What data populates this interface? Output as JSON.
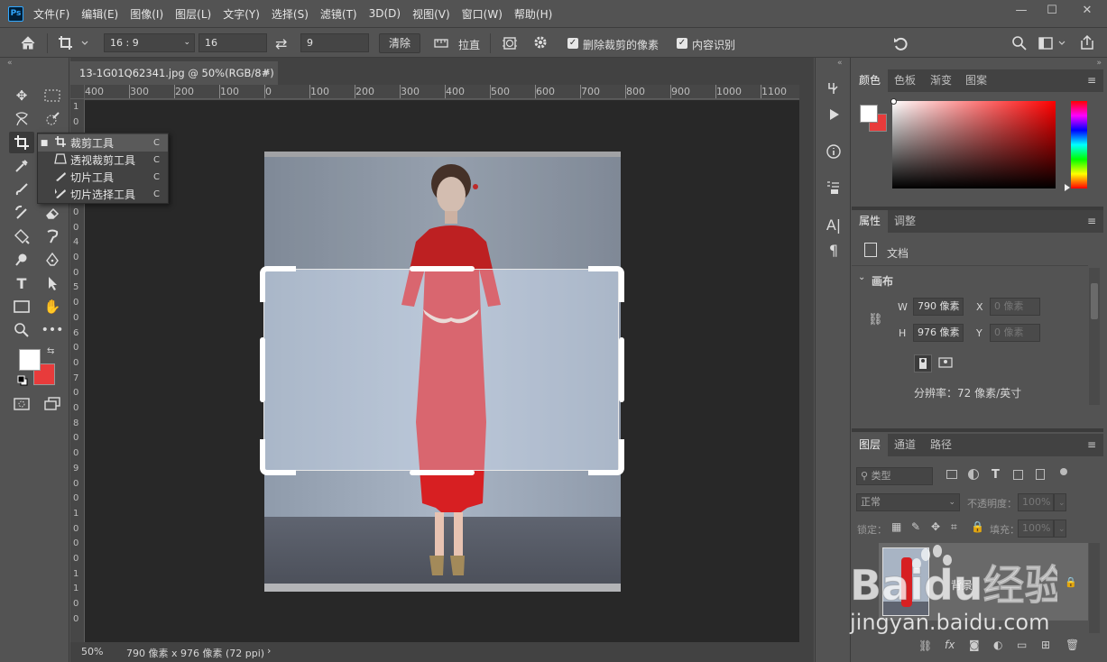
{
  "app": {
    "logo": "Ps"
  },
  "menu": [
    "文件(F)",
    "编辑(E)",
    "图像(I)",
    "图层(L)",
    "文字(Y)",
    "选择(S)",
    "滤镜(T)",
    "3D(D)",
    "视图(V)",
    "窗口(W)",
    "帮助(H)"
  ],
  "window_controls": {
    "minimize": "—",
    "maximize": "☐",
    "close": "✕"
  },
  "options": {
    "ratio_preset": "16 : 9",
    "width_value": "16",
    "swap_icon": "⇄",
    "height_value": "9",
    "clear_label": "清除",
    "straighten_label": "拉直",
    "delete_cropped_label": "删除裁剪的像素",
    "content_aware_label": "内容识别",
    "delete_cropped_checked": "✓",
    "content_aware_checked": "✓"
  },
  "document": {
    "tab_title": "13-1G01Q62341.jpg @ 50%(RGB/8#)",
    "tab_close": "✕",
    "zoom": "50%",
    "doc_info": "790 像素 x 976 像素 (72 ppi)"
  },
  "ruler_top": [
    "400",
    "300",
    "200",
    "100",
    "0",
    "100",
    "200",
    "300",
    "400",
    "500",
    "600",
    "700",
    "800",
    "900",
    "1000",
    "1100"
  ],
  "ruler_left": [
    "1",
    "0",
    "0",
    "2",
    "0",
    "0",
    "3",
    "0",
    "0",
    "4",
    "0",
    "0",
    "5",
    "0",
    "0",
    "6",
    "0",
    "0",
    "7",
    "0",
    "0",
    "8",
    "0",
    "0",
    "9",
    "0",
    "0",
    "1",
    "0",
    "0",
    "0",
    "1",
    "1",
    "0",
    "0"
  ],
  "flyout": {
    "items": [
      {
        "label": "裁剪工具",
        "key": "C",
        "icon": "⌗"
      },
      {
        "label": "透视裁剪工具",
        "key": "C",
        "icon": "⊞"
      },
      {
        "label": "切片工具",
        "key": "C",
        "icon": "✎"
      },
      {
        "label": "切片选择工具",
        "key": "C",
        "icon": "✎"
      }
    ]
  },
  "color_panel": {
    "tabs": [
      "颜色",
      "色板",
      "渐变",
      "图案"
    ],
    "foreground": "#ffffff",
    "background": "#e83b3b",
    "hue": "#ff0000"
  },
  "properties_panel": {
    "tabs": [
      "属性",
      "调整"
    ],
    "doc_label": "文档",
    "section": "画布",
    "w_label": "W",
    "w_value": "790 像素",
    "h_label": "H",
    "h_value": "976 像素",
    "x_label": "X",
    "x_placeholder": "0 像素",
    "y_label": "Y",
    "y_placeholder": "0 像素",
    "resolution": "分辨率：72 像素/英寸"
  },
  "layers_panel": {
    "tabs": [
      "图层",
      "通道",
      "路径"
    ],
    "filter_label": "类型",
    "blend_mode": "正常",
    "opacity_label": "不透明度：",
    "opacity_value": "100%",
    "lock_label": "锁定：",
    "fill_label": "填充：",
    "fill_value": "100%",
    "layer_name": "背景",
    "footer_fx": "fx"
  },
  "watermark": {
    "brand": "Baidu经验",
    "url": "jingyan.baidu.com"
  }
}
